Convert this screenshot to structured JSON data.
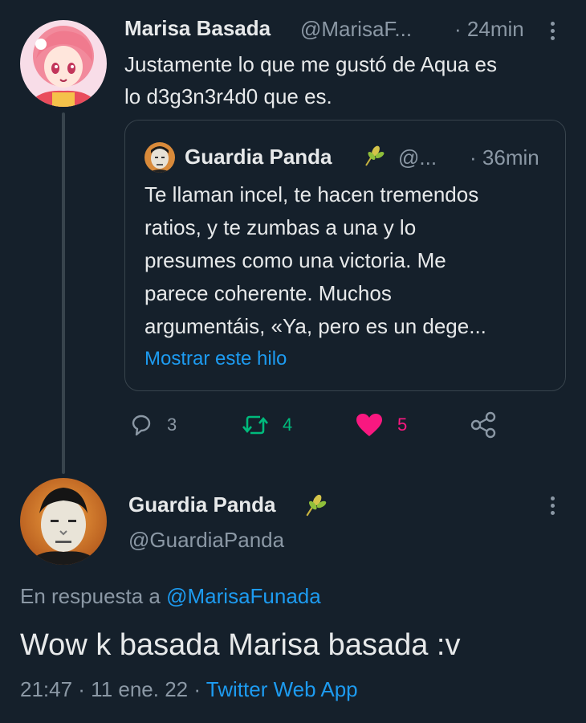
{
  "colors": {
    "background": "#15202b",
    "text_primary": "#e7e9ea",
    "text_secondary": "#8b98a5",
    "link": "#1d9bf0",
    "retweet_green": "#00ba7c",
    "like_pink": "#f91880",
    "border": "#38444d"
  },
  "tweet1": {
    "author_name": "Marisa Basada",
    "handle": "@MarisaF...",
    "time_sep": "·",
    "time": "24min",
    "text_line1": "Justamente lo que me gustó de Aqua es",
    "text_line2": "lo d3g3n3r4d0 que es.",
    "avatar_icon": "anime-girl-avatar",
    "quote": {
      "author_name": "Guardia Panda",
      "badge_icon": "wheat-icon",
      "handle": "@...",
      "time_sep": "·",
      "time": "36min",
      "text_lines": [
        "Te llaman incel, te hacen tremendos",
        "ratios, y te zumbas a una y lo",
        "presumes como una victoria. Me",
        "parece coherente. Muchos",
        "argumentáis, «Ya, pero es un dege..."
      ],
      "show_thread": "Mostrar este hilo"
    },
    "actions": {
      "reply_count": "3",
      "retweet_count": "4",
      "like_count": "5",
      "liked": true
    }
  },
  "tweet2": {
    "author_name": "Guardia Panda",
    "badge_icon": "wheat-icon",
    "handle": "@GuardiaPanda",
    "reply_prefix": "En respuesta a",
    "reply_mention": "@MarisaFunada",
    "text": "Wow k basada Marisa basada :v",
    "timestamp": "21:47 · 11 ene. 22 ·",
    "source": "Twitter Web App"
  }
}
